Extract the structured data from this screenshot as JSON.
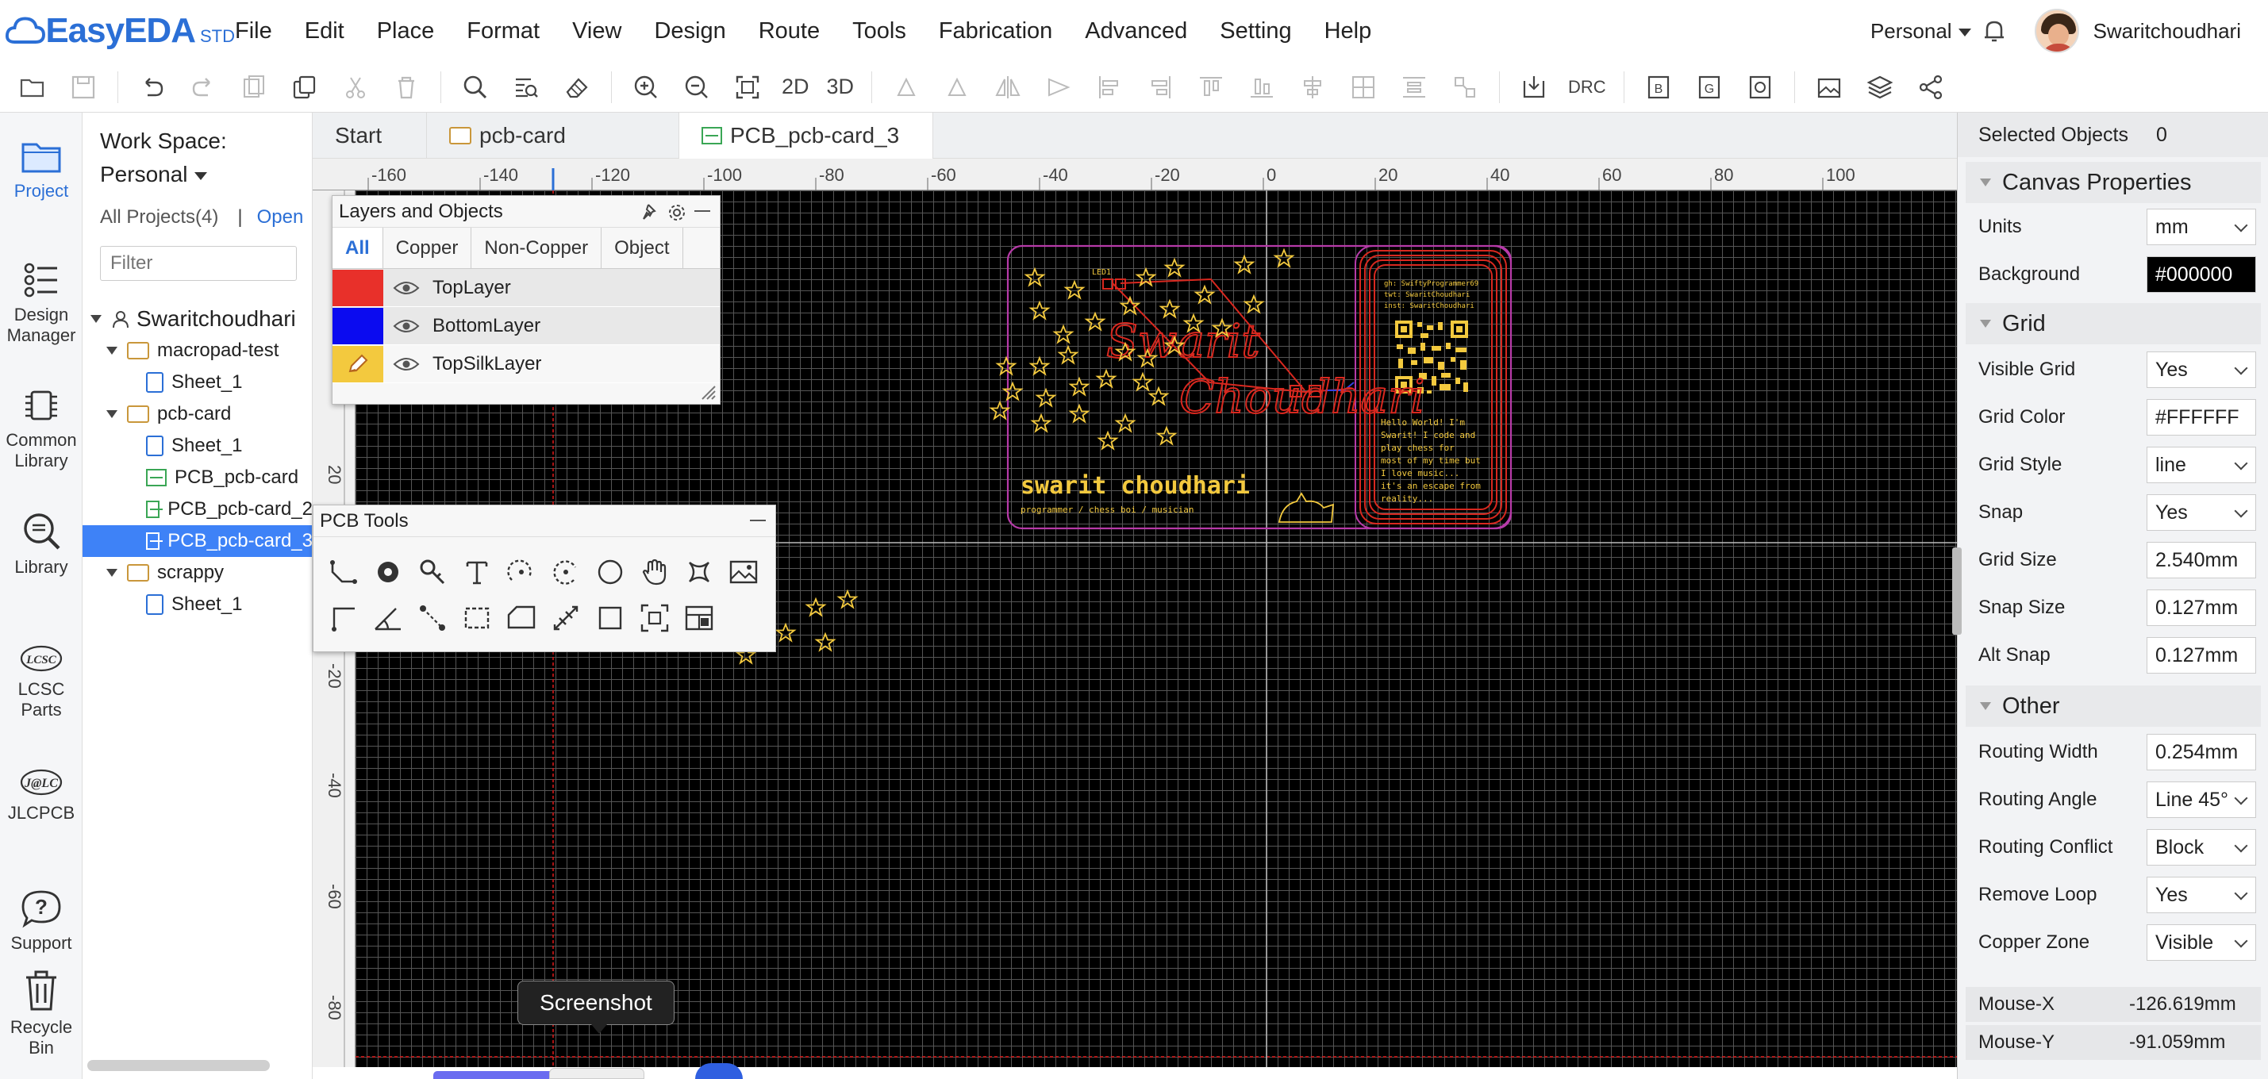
{
  "app": {
    "logo": "EasyEDA",
    "logo_edition": "STD"
  },
  "menu": [
    "File",
    "Edit",
    "Place",
    "Format",
    "View",
    "Design",
    "Route",
    "Tools",
    "Fabrication",
    "Advanced",
    "Setting",
    "Help"
  ],
  "account": {
    "workspace": "Personal",
    "username": "Swaritchoudhari"
  },
  "toolbar": {
    "btn_2d": "2D",
    "btn_3d": "3D",
    "btn_drc": "DRC",
    "btn_b": "B",
    "btn_g": "G"
  },
  "leftbar": [
    {
      "label": "Project",
      "icon": "folder-icon"
    },
    {
      "label": "Design Manager",
      "icon": "design-manager-icon"
    },
    {
      "label": "Common Library",
      "icon": "chip-icon"
    },
    {
      "label": "Library",
      "icon": "library-search-icon"
    },
    {
      "label": "LCSC Parts",
      "icon": "lcsc-icon"
    },
    {
      "label": "JLCPCB",
      "icon": "jlc-icon"
    },
    {
      "label": "Support",
      "icon": "help-icon"
    },
    {
      "label": "Recycle Bin",
      "icon": "trash-icon"
    }
  ],
  "project": {
    "workspace_label": "Work Space:",
    "workspace_value": "Personal",
    "all_projects": "All Projects(4)",
    "separator": "|",
    "open": "Open",
    "filter_placeholder": "Filter",
    "tree": [
      {
        "label": "Swaritchoudhari",
        "type": "user"
      },
      {
        "label": "macropad-test",
        "type": "folder"
      },
      {
        "label": "Sheet_1",
        "type": "sheet"
      },
      {
        "label": "pcb-card",
        "type": "folder"
      },
      {
        "label": "Sheet_1",
        "type": "sheet"
      },
      {
        "label": "PCB_pcb-card",
        "type": "pcb"
      },
      {
        "label": "PCB_pcb-card_2",
        "type": "pcb"
      },
      {
        "label": "PCB_pcb-card_3",
        "type": "pcb",
        "selected": true
      },
      {
        "label": "scrappy",
        "type": "folder"
      },
      {
        "label": "Sheet_1",
        "type": "sheet"
      }
    ]
  },
  "tabs": [
    {
      "label": "Start"
    },
    {
      "label": "pcb-card"
    },
    {
      "label": "PCB_pcb-card_3",
      "active": true
    }
  ],
  "ruler": {
    "top": [
      "-160",
      "-140",
      "-120",
      "-100",
      "-80",
      "-60",
      "-40",
      "-20",
      "0",
      "20",
      "40",
      "60",
      "80",
      "100"
    ],
    "left": [
      "20",
      "-20",
      "-40",
      "-60",
      "-80"
    ]
  },
  "layers_panel": {
    "title": "Layers and Objects",
    "tabs": [
      "All",
      "Copper",
      "Non-Copper",
      "Object"
    ],
    "layers": [
      {
        "name": "TopLayer",
        "color": "#e8302a"
      },
      {
        "name": "BottomLayer",
        "color": "#0b0bf0"
      },
      {
        "name": "TopSilkLayer",
        "color": "#f3c93e"
      }
    ]
  },
  "pcb_tools": {
    "title": "PCB Tools"
  },
  "pcb_card": {
    "name_cursive_1": "Swarit",
    "name_cursive_2": "Choudhari",
    "name": "swarit choudhari",
    "tagline": "programmer / chess boi / musician",
    "led_label": "LED1",
    "contact_1": "gh: SwiftyProgrammer69",
    "contact_2": "twt: SwaritChoudhari",
    "contact_3": "inst: SwaritChoudhari",
    "bio_1": "Hello World! I'm",
    "bio_2": "Swarit! I code and",
    "bio_3": "play chess for",
    "bio_4": "most of my time but",
    "bio_5": "I love music...",
    "bio_6": "it's an escape from",
    "bio_7": "reality..."
  },
  "properties": {
    "selected_label": "Selected Objects",
    "selected_count": "0",
    "canvas_head": "Canvas Properties",
    "grid_head": "Grid",
    "other_head": "Other",
    "rows": [
      {
        "label": "Units",
        "value": "mm",
        "dropdown": true
      },
      {
        "label": "Background",
        "value": "#000000",
        "dropdown": false,
        "dark": true
      },
      {
        "label": "Visible Grid",
        "value": "Yes",
        "dropdown": true
      },
      {
        "label": "Grid Color",
        "value": "#FFFFFF",
        "dropdown": false
      },
      {
        "label": "Grid Style",
        "value": "line",
        "dropdown": true
      },
      {
        "label": "Snap",
        "value": "Yes",
        "dropdown": true
      },
      {
        "label": "Grid Size",
        "value": "2.540mm",
        "dropdown": false
      },
      {
        "label": "Snap Size",
        "value": "0.127mm",
        "dropdown": false
      },
      {
        "label": "Alt Snap",
        "value": "0.127mm",
        "dropdown": false
      },
      {
        "label": "Routing Width",
        "value": "0.254mm",
        "dropdown": false
      },
      {
        "label": "Routing Angle",
        "value": "Line 45°",
        "dropdown": true
      },
      {
        "label": "Routing Conflict",
        "value": "Block",
        "dropdown": true
      },
      {
        "label": "Remove Loop",
        "value": "Yes",
        "dropdown": true
      },
      {
        "label": "Copper Zone",
        "value": "Visible",
        "dropdown": true
      }
    ],
    "mouse_x_label": "Mouse-X",
    "mouse_x": "-126.619mm",
    "mouse_y_label": "Mouse-Y",
    "mouse_y": "-91.059mm"
  },
  "tooltip": "Screenshot",
  "colors": {
    "accent": "#2b6fd6",
    "selected": "#3e82f7",
    "silk": "#f3c93e",
    "copper": "#d8281f",
    "outline": "#b63aa8"
  }
}
